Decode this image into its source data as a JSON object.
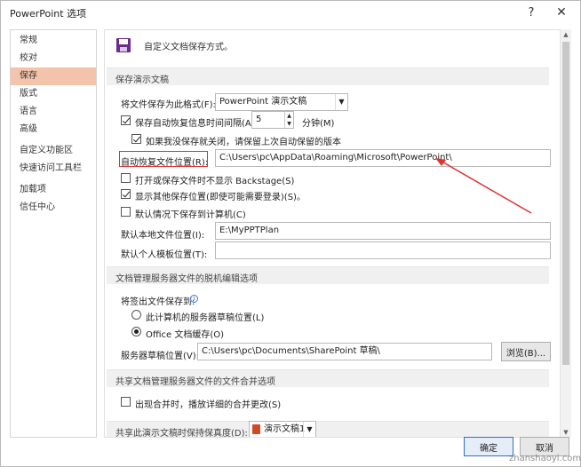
{
  "window": {
    "title": "PowerPoint 选项"
  },
  "titlebar": {
    "help_glyph": "?",
    "close_glyph": "✕"
  },
  "sidebar": {
    "items": [
      {
        "label": "常规"
      },
      {
        "label": "校对"
      },
      {
        "label": "保存",
        "active": true
      },
      {
        "label": "版式"
      },
      {
        "label": "语言"
      },
      {
        "label": "高级"
      },
      {
        "label": "自定义功能区"
      },
      {
        "label": "快速访问工具栏"
      },
      {
        "label": "加载项"
      },
      {
        "label": "信任中心"
      }
    ]
  },
  "header": {
    "text": "自定义文档保存方式。",
    "icon": "floppy-disk-icon"
  },
  "save_presentations": {
    "section_title": "保存演示文稿",
    "format_label": "将文件保存为此格式(F):",
    "format_value": "PowerPoint 演示文稿",
    "autorecover_label": "保存自动恢复信息时间间隔(A)",
    "autorecover_checked": true,
    "autorecover_minutes": "5",
    "minutes_label": "分钟(M)",
    "keep_last_label": "如果我没保存就关闭，请保留上次自动保留的版本",
    "keep_last_checked": true,
    "autorecover_location_label": "自动恢复文件位置(R):",
    "autorecover_location_value": "C:\\Users\\pc\\AppData\\Roaming\\Microsoft\\PowerPoint\\",
    "no_backstage_label": "打开或保存文件时不显示 Backstage(S)",
    "no_backstage_checked": false,
    "show_other_locations_label": "显示其他保存位置(即使可能需要登录)(S)。",
    "show_other_locations_checked": true,
    "save_to_computer_label": "默认情况下保存到计算机(C)",
    "save_to_computer_checked": false,
    "local_location_label": "默认本地文件位置(I):",
    "local_location_value": "E:\\MyPPTPlan",
    "template_location_label": "默认个人模板位置(T):",
    "template_location_value": ""
  },
  "offline_editing": {
    "section_title": "文档管理服务器文件的脱机编辑选项",
    "save_checked_out_label": "将签出文件保存到:",
    "info_glyph": "i",
    "server_drafts_option": "此计算机的服务器草稿位置(L)",
    "server_drafts_selected": false,
    "office_cache_option": "Office 文档缓存(O)",
    "office_cache_selected": true,
    "drafts_location_label": "服务器草稿位置(V):",
    "drafts_location_value": "C:\\Users\\pc\\Documents\\SharePoint 草稿\\",
    "browse_label": "浏览(B)..."
  },
  "merge_options": {
    "section_title": "共享文档管理服务器文件的文件合并选项",
    "show_merge_label": "出现合并时，播放详细的合并更改(S)",
    "show_merge_checked": false
  },
  "fidelity": {
    "section_title": "共享此演示文稿时保持保真度(D):",
    "presentation_value": "演示文稿1"
  },
  "footer": {
    "ok_label": "确定",
    "cancel_label": "取消"
  },
  "watermark": {
    "text": "zhanshaoyi.com"
  },
  "colors": {
    "active_nav": "#f4c3ab",
    "highlight_box": "#e03030",
    "arrow": "#e03030"
  }
}
